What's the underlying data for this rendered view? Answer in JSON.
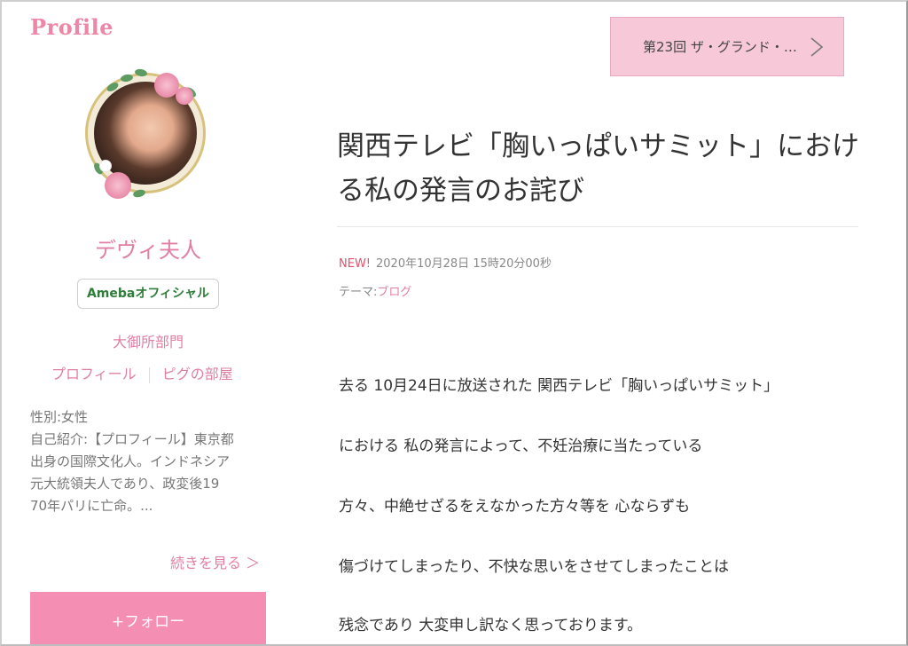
{
  "sidebar": {
    "heading": "Profile",
    "name": "デヴィ夫人",
    "badge": "Amebaオフィシャル",
    "category": "大御所部門",
    "links": [
      "プロフィール",
      "ピグの部屋"
    ],
    "bio_lines": [
      "性別:女性",
      "自己紹介:【プロフィール】東京都",
      "出身の国際文化人。インドネシア",
      "元大統領夫人であり、政変後19",
      "70年パリに亡命。..."
    ],
    "more_link": "続きを見る ＞",
    "follow_button": "+フォロー",
    "avatar_icon": "profile-photo"
  },
  "main": {
    "next_post": "第23回 ザ・グランド・…",
    "title_lines": [
      "関西テレビ「胸いっぱいサミット」におけ",
      "る私の発言のお詫び"
    ],
    "new_label": "NEW!",
    "datetime": "2020年10月28日 15時20分00秒",
    "theme_label": "テーマ:",
    "theme_value": "ブログ",
    "body_lines": [
      "去る 10月24日に放送された 関西テレビ「胸いっぱいサミット」",
      "における 私の発言によって、不妊治療に当たっている",
      "方々、中絶せざるをえなかった方々等を 心ならずも",
      "傷づけてしまったり、不快な思いをさせてしまったことは",
      "残念であり 大変申し訳なく思っております。"
    ]
  },
  "colors": {
    "accent": "#e07fa3",
    "follow_bg": "#f58eb3",
    "next_post_bg": "#f7c8d8",
    "new_label": "#e2506c"
  }
}
